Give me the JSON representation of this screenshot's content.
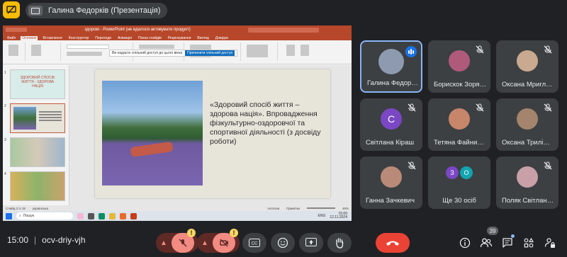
{
  "header": {
    "presenter_label": "Галина Федорків (Презентація)"
  },
  "powerpoint": {
    "title": "здорові - PowerPoint (не вдалося активувати продукт)",
    "tabs": [
      "Файл",
      "Основне",
      "Вставлення",
      "Конструктор",
      "Переходи",
      "Анімація",
      "Показ слайдів",
      "Рецензування",
      "Вигляд",
      "Довідка"
    ],
    "active_tab": "Основне",
    "notice_text": "Ви надаєте спільний доступ до цього вікна",
    "notice_button": "Припинити спільний доступ",
    "slide_text": "«Здоровий спосіб життя – здорова нація». Впровадження фізкультурно-оздоровчої та спортивної діяльності (з досвіду роботи)",
    "thumb_title": "ЗДОРОВИЙ СПОСІБ ЖИТТЯ - ЗДОРОВА НАЦІЯ",
    "thumbs": [
      "1",
      "2",
      "3",
      "4"
    ],
    "status_left": "Слайд 2 із 15",
    "status_lang": "українська",
    "status_notes": "Нотатки",
    "status_comments": "Примітки",
    "zoom": "45%",
    "taskbar_search": "Пошук",
    "taskbar_time": "15:00",
    "taskbar_date": "12.11.2024",
    "taskbar_lang": "ENG"
  },
  "participants": [
    {
      "name": "Галина Федор…",
      "speaking": true,
      "avatar_color": "#8e9aaf"
    },
    {
      "name": "Борискок Зоря…",
      "muted": true,
      "avatar_color": "#b05a7a"
    },
    {
      "name": "Оксана Мригл…",
      "muted": true,
      "avatar_color": "#c9a98f"
    },
    {
      "name": "Світлана Кіраш",
      "muted": true,
      "initial": "C",
      "avatar_color": "#7b47c4"
    },
    {
      "name": "Тетяна Файни…",
      "muted": true,
      "avatar_color": "#c7866a"
    },
    {
      "name": "Оксана Трилі…",
      "muted": true,
      "avatar_color": "#a4846c"
    },
    {
      "name": "Ганна Зачкевич",
      "muted": true,
      "avatar_color": "#b98a78"
    },
    {
      "name": "Ще 30 осіб",
      "more": true,
      "initials": [
        "З",
        "О"
      ],
      "avatar_colors": [
        "#7b47c4",
        "#12a4af"
      ]
    },
    {
      "name": "Поляк Світлан…",
      "muted": true,
      "avatar_color": "#c9a0a8"
    }
  ],
  "bottom": {
    "time": "15:00",
    "meeting_code": "ocv-driy-vjh",
    "participant_count": "39",
    "warning_mark": "!"
  },
  "colors": {
    "accent": "#8ab4f8",
    "hangup": "#ea4335",
    "muted_control": "#f28b82",
    "ppt_red": "#b7472a"
  }
}
